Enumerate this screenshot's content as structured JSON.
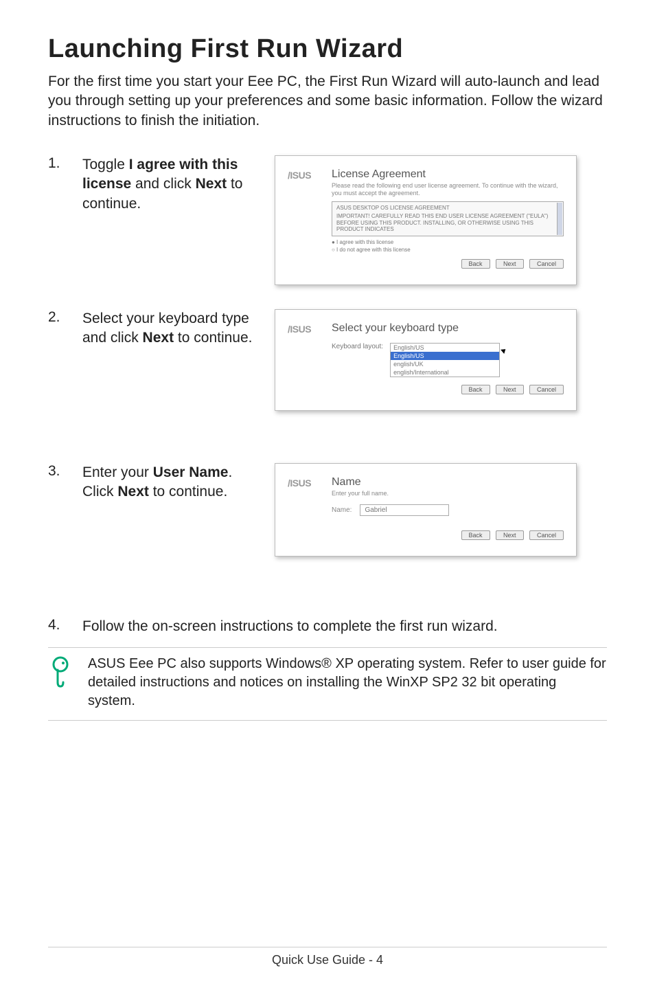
{
  "title": "Launching First Run Wizard",
  "intro": "For the first time you start your Eee PC, the First Run Wizard will auto-launch and lead you through setting up your preferences and some basic information. Follow the wizard instructions to finish the initiation.",
  "steps": {
    "s1": {
      "num": "1.",
      "pre": "Toggle ",
      "b1": "I agree with this license",
      "mid": " and click ",
      "b2": "Next",
      "post": " to continue."
    },
    "s2": {
      "num": "2.",
      "pre": "Select your keyboard type and click ",
      "b1": "Next",
      "post": " to continue."
    },
    "s3": {
      "num": "3.",
      "pre": "Enter your ",
      "b1": "User Name",
      "mid": ". Click ",
      "b2": "Next",
      "post": " to continue."
    },
    "s4": {
      "num": "4.",
      "text": "Follow the on-screen instructions to complete the first run wizard."
    }
  },
  "shot1": {
    "title": "License Agreement",
    "sub": "Please read the following end user license agreement. To continue with the wizard, you must accept the agreement.",
    "boxline1": "ASUS DESKTOP OS LICENSE AGREEMENT",
    "boxline2": "IMPORTANT! CAREFULLY READ THIS END USER LICENSE AGREEMENT (\"EULA\") BEFORE USING THIS PRODUCT. INSTALLING, OR OTHERWISE USING THIS PRODUCT INDICATES",
    "radio1": "● I agree with this license",
    "radio2": "○ I do not agree with this license",
    "back": "Back",
    "next": "Next",
    "cancel": "Cancel"
  },
  "shot2": {
    "title": "Select your keyboard type",
    "label": "Keyboard layout:",
    "opt1": "English/US",
    "opt2": "English/US",
    "opt3": "english/UK",
    "opt4": "english/International",
    "back": "Back",
    "next": "Next",
    "cancel": "Cancel"
  },
  "shot3": {
    "title": "Name",
    "sub": "Enter your full name.",
    "label": "Name:",
    "value": "Gabriel",
    "back": "Back",
    "next": "Next",
    "cancel": "Cancel"
  },
  "note": "ASUS Eee PC also supports Windows® XP operating system. Refer to user guide for detailed instructions and notices on installing the WinXP SP2 32 bit operating system.",
  "footer": "Quick Use Guide - 4"
}
